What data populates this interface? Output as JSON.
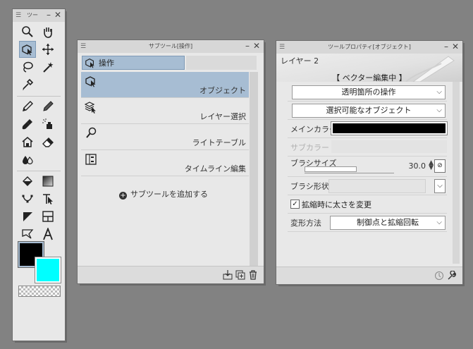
{
  "tool_palette": {
    "title": "ツー"
  },
  "sub_tool": {
    "title": "サブツール[操作]",
    "tab_label": "操作",
    "items": [
      {
        "label": "オブジェクト",
        "icon": "object-select-icon",
        "selected": true
      },
      {
        "label": "レイヤー選択",
        "icon": "layer-select-icon",
        "selected": false
      },
      {
        "label": "ライトテーブル",
        "icon": "light-table-icon",
        "selected": false
      },
      {
        "label": "タイムライン編集",
        "icon": "timeline-edit-icon",
        "selected": false
      }
    ],
    "add_label": "サブツールを追加する"
  },
  "tool_property": {
    "title": "ツールプロパティ[オブジェクト]",
    "layer_name": "レイヤー 2",
    "status": "【 ベクター編集中 】",
    "transparent_op": "透明箇所の操作",
    "selectable_object": "選択可能なオブジェクト",
    "main_color_label": "メインカラー",
    "sub_color_label": "サブカラー",
    "brush_size_label": "ブラシサイズ",
    "brush_size_value": "30.0",
    "brush_size_fraction": 0.3,
    "brush_shape_label": "ブラシ形状",
    "scale_width_label": "拡縮時に太さを変更",
    "scale_width_checked": true,
    "transform_label": "変形方法",
    "transform_value": "制御点と拡縮回転"
  },
  "colors": {
    "main": "#000000",
    "sub": "#00ffff",
    "selection": "#a7bdd3",
    "background": "#828282"
  }
}
